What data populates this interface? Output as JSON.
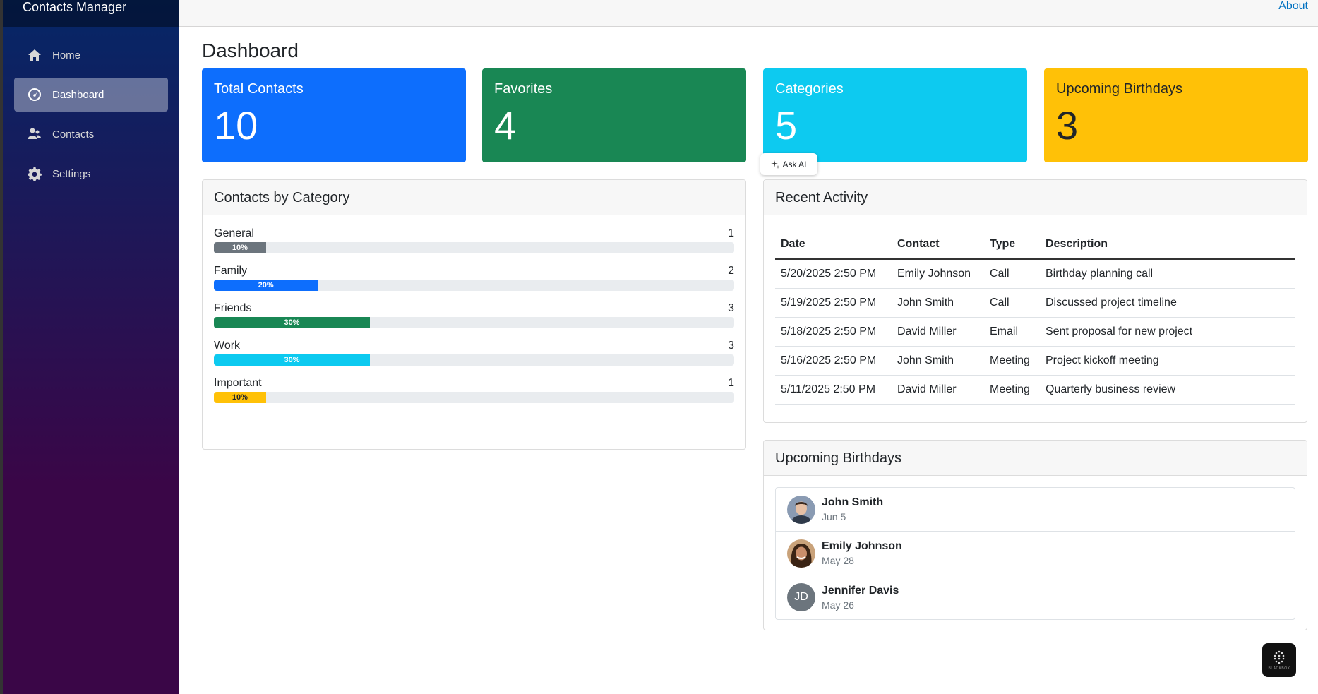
{
  "app": {
    "title": "Contacts Manager"
  },
  "colors": {
    "primary": "#0d6efd",
    "success": "#198754",
    "info": "#0dcaf0",
    "warning": "#ffc107",
    "secondary": "#6c757d"
  },
  "sidebar": {
    "items": [
      {
        "label": "Home",
        "icon": "home-icon",
        "active": false
      },
      {
        "label": "Dashboard",
        "icon": "dashboard-icon",
        "active": true
      },
      {
        "label": "Contacts",
        "icon": "contacts-icon",
        "active": false
      },
      {
        "label": "Settings",
        "icon": "gear-icon",
        "active": false
      }
    ]
  },
  "topbar": {
    "about": "About"
  },
  "page": {
    "title": "Dashboard"
  },
  "stats": [
    {
      "label": "Total Contacts",
      "value": "10",
      "color": "#0d6efd"
    },
    {
      "label": "Favorites",
      "value": "4",
      "color": "#198754"
    },
    {
      "label": "Categories",
      "value": "5",
      "color": "#0dcaf0"
    },
    {
      "label": "Upcoming Birthdays",
      "value": "3",
      "color": "#ffc107"
    }
  ],
  "ask_ai": {
    "label": "Ask AI",
    "icon": "sparkle-icon"
  },
  "categories": {
    "title": "Contacts by Category",
    "rows": [
      {
        "name": "General",
        "count": "1",
        "percent_label": "10%",
        "percent": 10,
        "color": "#6c757d"
      },
      {
        "name": "Family",
        "count": "2",
        "percent_label": "20%",
        "percent": 20,
        "color": "#0d6efd"
      },
      {
        "name": "Friends",
        "count": "3",
        "percent_label": "30%",
        "percent": 30,
        "color": "#198754"
      },
      {
        "name": "Work",
        "count": "3",
        "percent_label": "30%",
        "percent": 30,
        "color": "#0dcaf0"
      },
      {
        "name": "Important",
        "count": "1",
        "percent_label": "10%",
        "percent": 10,
        "color": "#ffc107"
      }
    ]
  },
  "activity": {
    "title": "Recent Activity",
    "columns": [
      "Date",
      "Contact",
      "Type",
      "Description"
    ],
    "rows": [
      [
        "5/20/2025 2:50 PM",
        "Emily Johnson",
        "Call",
        "Birthday planning call"
      ],
      [
        "5/19/2025 2:50 PM",
        "John Smith",
        "Call",
        "Discussed project timeline"
      ],
      [
        "5/18/2025 2:50 PM",
        "David Miller",
        "Email",
        "Sent proposal for new project"
      ],
      [
        "5/16/2025 2:50 PM",
        "John Smith",
        "Meeting",
        "Project kickoff meeting"
      ],
      [
        "5/11/2025 2:50 PM",
        "David Miller",
        "Meeting",
        "Quarterly business review"
      ]
    ]
  },
  "birthdays": {
    "title": "Upcoming Birthdays",
    "items": [
      {
        "name": "John Smith",
        "date": "Jun 5",
        "avatar": "photo"
      },
      {
        "name": "Emily Johnson",
        "date": "May 28",
        "avatar": "photo"
      },
      {
        "name": "Jennifer Davis",
        "date": "May 26",
        "avatar": "initials",
        "initials": "JD"
      }
    ]
  },
  "floating": {
    "label": "BLACKBOX",
    "icon": "blackbox-icon"
  }
}
